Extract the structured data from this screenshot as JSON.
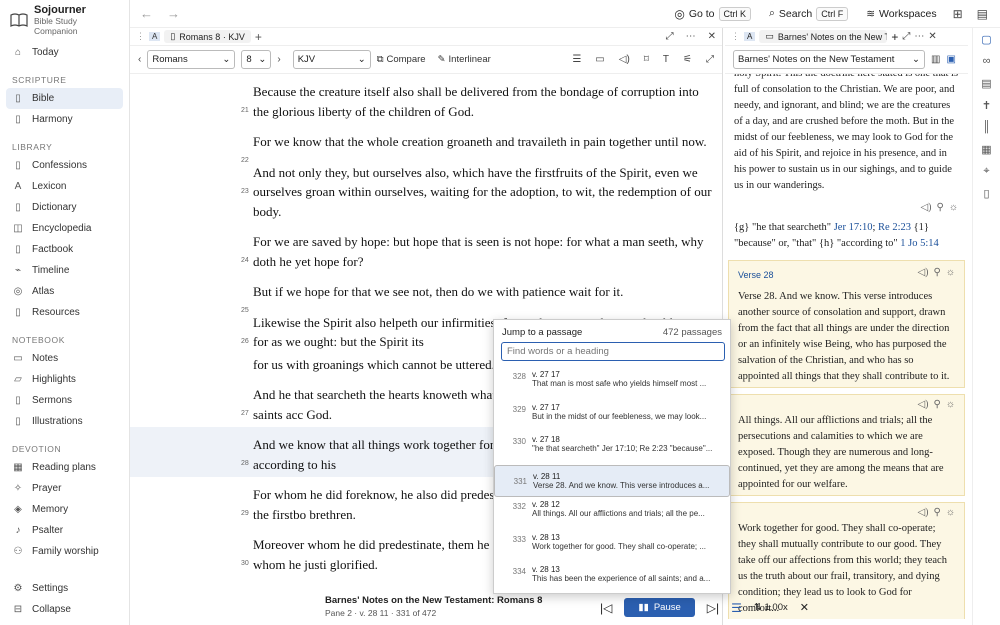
{
  "app": {
    "name": "Sojourner",
    "subtitle": "Bible Study Companion"
  },
  "sidebar": {
    "top": [
      {
        "label": "Today",
        "icon": "home-icon"
      }
    ],
    "sections": [
      {
        "title": "SCRIPTURE",
        "items": [
          {
            "label": "Bible",
            "active": true
          },
          {
            "label": "Harmony"
          }
        ]
      },
      {
        "title": "LIBRARY",
        "items": [
          {
            "label": "Confessions"
          },
          {
            "label": "Lexicon"
          },
          {
            "label": "Dictionary"
          },
          {
            "label": "Encyclopedia"
          },
          {
            "label": "Factbook"
          },
          {
            "label": "Timeline"
          },
          {
            "label": "Atlas"
          },
          {
            "label": "Resources"
          }
        ]
      },
      {
        "title": "NOTEBOOK",
        "items": [
          {
            "label": "Notes"
          },
          {
            "label": "Highlights"
          },
          {
            "label": "Sermons"
          },
          {
            "label": "Illustrations"
          }
        ]
      },
      {
        "title": "DEVOTION",
        "items": [
          {
            "label": "Reading plans"
          },
          {
            "label": "Prayer"
          },
          {
            "label": "Memory"
          },
          {
            "label": "Psalter"
          },
          {
            "label": "Family worship"
          }
        ]
      }
    ],
    "footer": [
      {
        "label": "Settings"
      },
      {
        "label": "Collapse"
      }
    ]
  },
  "topbar": {
    "goto": "Go to",
    "goto_kbd": "Ctrl K",
    "search": "Search",
    "search_kbd": "Ctrl F",
    "workspaces": "Workspaces"
  },
  "pane1": {
    "tab_title": "Romans 8 · KJV",
    "book": "Romans",
    "chapter": "8",
    "version": "KJV",
    "compare": "Compare",
    "interlinear": "Interlinear",
    "verses": [
      {
        "n": "21",
        "text": "Because the creature itself also shall be delivered from the bondage of corruption into the glorious liberty of the children of God."
      },
      {
        "n": "22",
        "text": "For we know that the whole creation groaneth and travaileth in pain together until now."
      },
      {
        "n": "23",
        "text": "And not only they, but ourselves also, which have the firstfruits of the Spirit, even we ourselves groan within ourselves, waiting for the adoption, to wit, the redemption of our body."
      },
      {
        "n": "24",
        "text": "For we are saved by hope: but hope that is seen is not hope: for what a man seeth, why doth he yet hope for?"
      },
      {
        "n": "25",
        "text": "But if we hope for that we see not, then do we with patience wait for it."
      },
      {
        "n": "26",
        "text": "Likewise the Spirit also helpeth our infirmities: for we know not what we should pray for as we ought: but the Spirit its"
      },
      {
        "n": "",
        "text": "for us with groanings which cannot be uttered."
      },
      {
        "n": "27",
        "text": "And he that searcheth the hearts knoweth what i because he maketh intercession for the saints acc God."
      },
      {
        "n": "28",
        "text": "And we know that all things work together for go God, to them who are the called according to his",
        "hl": true
      },
      {
        "n": "29",
        "text": "For whom he did foreknow, he also did predestin the image of his Son, that he might be the firstbo brethren."
      },
      {
        "n": "30",
        "text": "Moreover whom he did predestinate, them he als called, them he also justified: and whom he justi glorified."
      }
    ]
  },
  "pane2": {
    "tab_title": "Barnes' Notes on the New Testam",
    "select": "Barnes' Notes on the New Testament",
    "intro": "holy Spirit. This the doctrine here stated is one that is full of consolation to the Christian. We are poor, and needy, and ignorant, and blind; we are the creatures of a day, and are crushed before the moth. But in the midst of our feebleness, we may look to God for the aid of his Spirit, and rejoice in his presence, and in his power to sustain us in our sighings, and to guide us in our wanderings.",
    "footnote_a": "{g} \"he that searcheth\" ",
    "footnote_ref1": "Jer 17:10",
    "footnote_sep": "; ",
    "footnote_ref2": "Re 2:23",
    "footnote_b": " {1} \"because\" or, \"that\" {h} \"according to\" ",
    "footnote_ref3": "1 Jo 5:14",
    "verse_head": "Verse 28",
    "block1": "Verse 28. And we know. This verse introduces another source of consolation and support, drawn from the fact that all things are under the direction or an infinitely wise Being, who has purposed the salvation of the Christian, and who has so appointed all things that they shall contribute to it.",
    "block2": "All things. All our afflictions and trials; all the persecutions and calamities to which we are exposed. Though they are numerous and long-continued, yet they are among the means that are appointed for our welfare.",
    "block3": "Work together for good. They shall co-operate; they shall mutually contribute to our good. They take off our affections from this world; they teach us the truth about our frail, transitory, and dying condition; they lead us to look to God for comfort..."
  },
  "popup": {
    "title": "Jump to a passage",
    "count": "472 passages",
    "placeholder": "Find words or a heading",
    "rows": [
      {
        "n": "328",
        "ref": "v. 27 17",
        "text": "That man is most safe who yields himself most ..."
      },
      {
        "n": "329",
        "ref": "v. 27 17",
        "text": "But in the midst of our feebleness, we may look..."
      },
      {
        "n": "330",
        "ref": "v. 27 18",
        "text": "\"he that searcheth\" Jer 17:10; Re 2:23 \"because\"..."
      },
      {
        "n": "331",
        "ref": "v. 28 11",
        "text": "Verse 28. And we know. This verse introduces a...",
        "sel": true
      },
      {
        "n": "332",
        "ref": "v. 28 12",
        "text": "All things. All our afflictions and trials; all the pe..."
      },
      {
        "n": "333",
        "ref": "v. 28 13",
        "text": "Work together for good. They shall co-operate; ..."
      },
      {
        "n": "334",
        "ref": "v. 28 13",
        "text": "This has been the experience of all saints; and a..."
      }
    ]
  },
  "bottombar": {
    "title": "Barnes' Notes on the New Testament: Romans 8",
    "sub": "Pane 2 · v. 28 11 · 331 of 472",
    "pause": "Pause",
    "speed": "1.00x"
  }
}
